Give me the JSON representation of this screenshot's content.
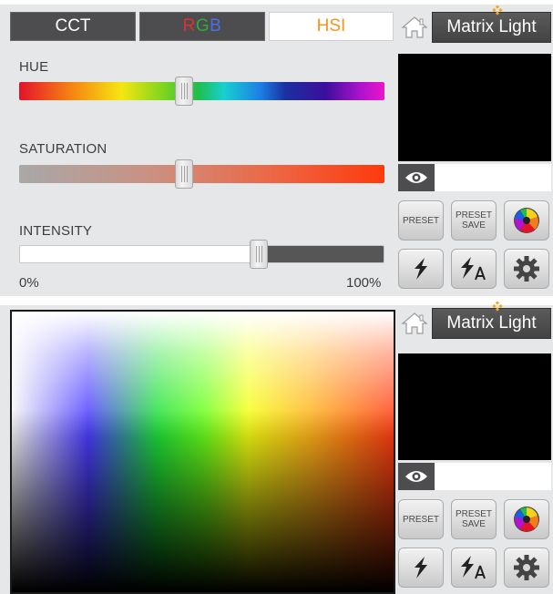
{
  "tabs": {
    "cct": "CCT",
    "rgb_r": "R",
    "rgb_g": "G",
    "rgb_b": "B",
    "hsi": "HSI",
    "active": "HSI"
  },
  "sliders": {
    "hue_label": "HUE",
    "saturation_label": "SATURATION",
    "intensity_label": "INTENSITY",
    "min_label": "0%",
    "max_label": "100%",
    "hue_value": 0.46,
    "saturation_value": 0.46,
    "intensity_value": 0.66
  },
  "brand": {
    "name": "Matrix Light"
  },
  "buttons": {
    "preset": "PRESET",
    "preset_save_line1": "PRESET",
    "preset_save_line2": "SAVE"
  },
  "icons": {
    "home": "home-icon",
    "eye": "eye-icon",
    "color_wheel": "color-wheel-icon",
    "effects": "lightning-icon",
    "effects_edit": "lightning-edit-icon",
    "settings": "gear-icon",
    "logo": "diamond-logo-icon"
  },
  "colors": {
    "accent": "#f7941d",
    "tab_dark": "#4d4d4f",
    "panel_bg": "#e6e7e9"
  }
}
